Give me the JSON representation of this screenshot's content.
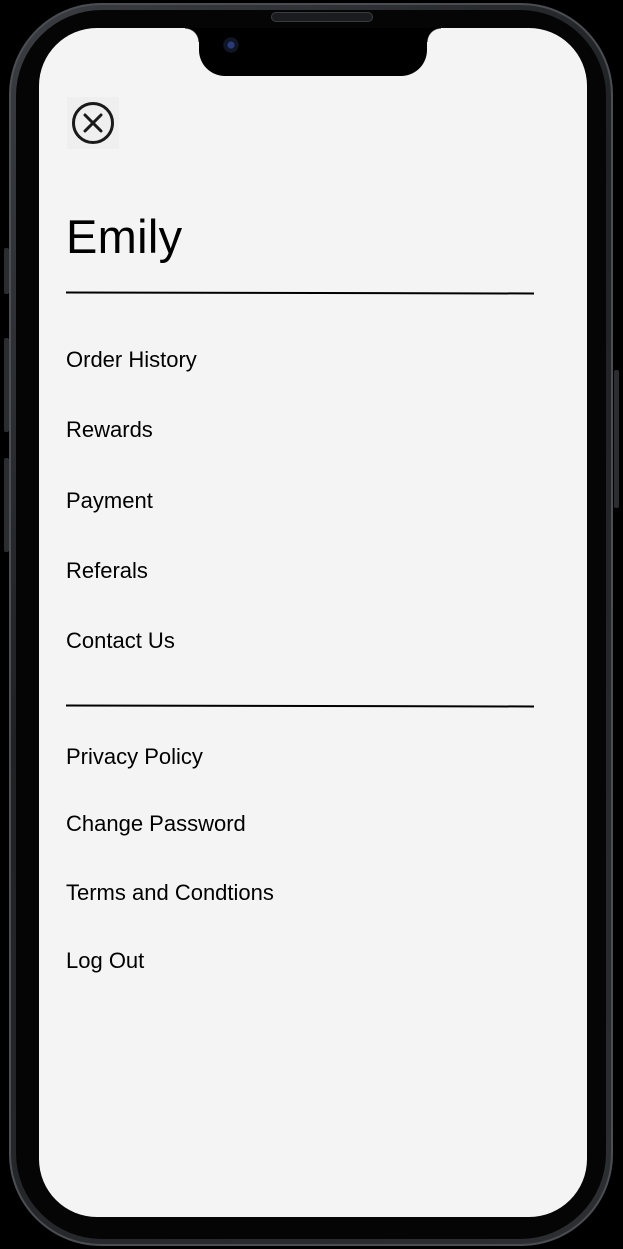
{
  "user": {
    "name": "Emily"
  },
  "icons": {
    "close": "close-circle-icon"
  },
  "menu": {
    "primary": [
      {
        "label": "Order History"
      },
      {
        "label": "Rewards"
      },
      {
        "label": "Payment"
      },
      {
        "label": "Referals"
      },
      {
        "label": "Contact Us"
      }
    ],
    "secondary": [
      {
        "label": "Privacy Policy"
      },
      {
        "label": "Change Password"
      },
      {
        "label": "Terms and Condtions"
      },
      {
        "label": "Log Out"
      }
    ]
  },
  "colors": {
    "screen_background": "#f4f4f4",
    "text": "#000000",
    "device_frame": "#2c2e32"
  }
}
